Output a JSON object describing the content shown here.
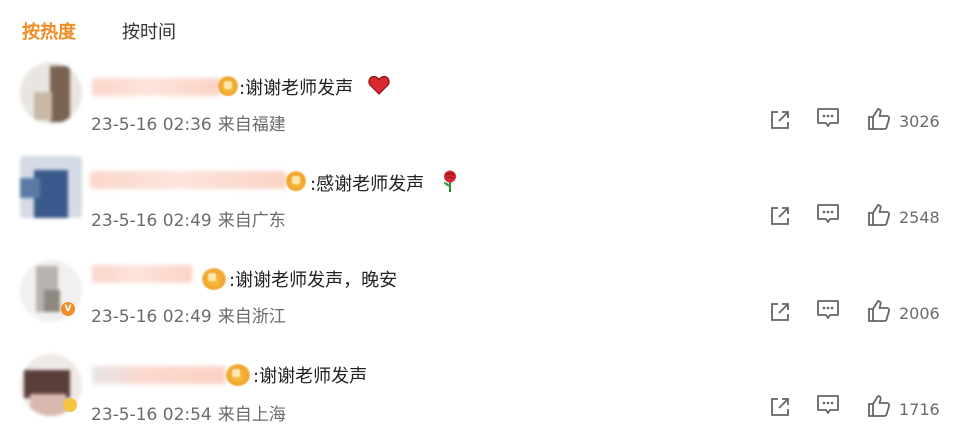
{
  "tabs": [
    {
      "label": "按热度",
      "active": true
    },
    {
      "label": "按时间",
      "active": false
    }
  ],
  "colors": {
    "accent": "#f08c24",
    "heart": "#d9282f",
    "text": "#222222",
    "meta": "#6b6b6b"
  },
  "comments": [
    {
      "text": ":谢谢老师发声",
      "emoji": "red-heart",
      "date": "23-5-16 02:36",
      "location": "来自福建",
      "likes": "3026"
    },
    {
      "text": ":感谢老师发声",
      "emoji": "rose",
      "date": "23-5-16 02:49",
      "location": "来自广东",
      "likes": "2548"
    },
    {
      "text": ":谢谢老师发声，晚安",
      "emoji": "",
      "date": "23-5-16 02:49",
      "location": "来自浙江",
      "likes": "2006"
    },
    {
      "text": ":谢谢老师发声",
      "emoji": "",
      "date": "23-5-16 02:54",
      "location": "来自上海",
      "likes": "1716"
    }
  ],
  "icons": {
    "share": "share-icon",
    "reply": "comment-icon",
    "like": "thumbs-up-icon"
  }
}
